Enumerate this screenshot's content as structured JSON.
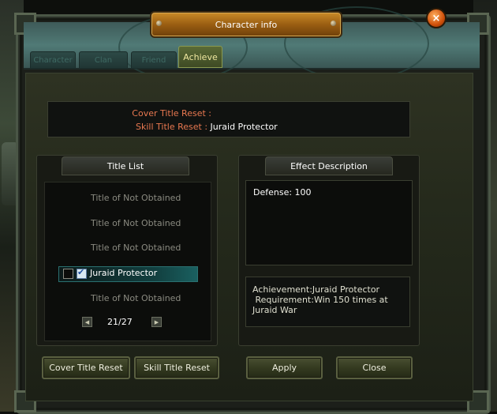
{
  "window": {
    "title": "Character info",
    "close_label": "×"
  },
  "tabs": [
    {
      "label": "Character",
      "active": false
    },
    {
      "label": "Clan",
      "active": false
    },
    {
      "label": "Friend",
      "active": false
    },
    {
      "label": "Achieve",
      "active": true
    }
  ],
  "reset_info": {
    "cover_label": "Cover Title Reset :",
    "cover_value": "",
    "skill_label": "Skill Title Reset :",
    "skill_value": "Juraid Protector"
  },
  "title_list": {
    "header": "Title List",
    "items": [
      {
        "label": "Title of Not Obtained",
        "selected": false
      },
      {
        "label": "Title of Not Obtained",
        "selected": false
      },
      {
        "label": "Title of Not Obtained",
        "selected": false
      },
      {
        "label": "Juraid Protector",
        "selected": true,
        "checkbox_left": false,
        "checkbox_right": true
      },
      {
        "label": "Title of Not Obtained",
        "selected": false
      }
    ],
    "page": "21/27",
    "prev_icon": "◀",
    "next_icon": "▶"
  },
  "effect": {
    "header": "Effect Description",
    "text": "Defense: 100",
    "requirement": "Achievement:Juraid Protector\n Requirement:Win 150 times at\nJuraid War"
  },
  "buttons": {
    "cover_reset": "Cover Title Reset",
    "skill_reset": "Skill Title Reset",
    "apply": "Apply",
    "close": "Close"
  },
  "colors": {
    "accent_orange": "#e87850",
    "title_bar": "#9a5e12",
    "header_teal": "#507a76",
    "selected_row": "#124040"
  }
}
